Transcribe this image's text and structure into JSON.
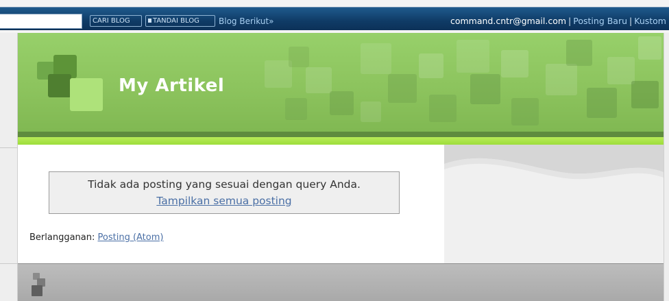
{
  "navbar": {
    "search_label": "CARI BLOG",
    "flag_label": "TANDAI BLOG",
    "next_blog_label": "Blog Berikut»",
    "user_email": "command.cntr@gmail.com",
    "separator": "|",
    "new_post_label": "Posting Baru",
    "customize_label": "Kustom"
  },
  "header": {
    "blog_title": "My Artikel"
  },
  "main": {
    "no_posts_message": "Tidak ada posting yang sesuai dengan query Anda.",
    "show_all_link": "Tampilkan semua posting",
    "subscribe_label": "Berlangganan:",
    "subscribe_link": "Posting (Atom)"
  },
  "colors": {
    "navbar_bg": "#0f3b66",
    "header_green": "#8cc35d",
    "accent_strip": "#9ddd3b",
    "link_blue": "#4a6fa5"
  },
  "icons": [
    "flag-icon",
    "blog-logo-icon",
    "footer-logo-icon"
  ]
}
